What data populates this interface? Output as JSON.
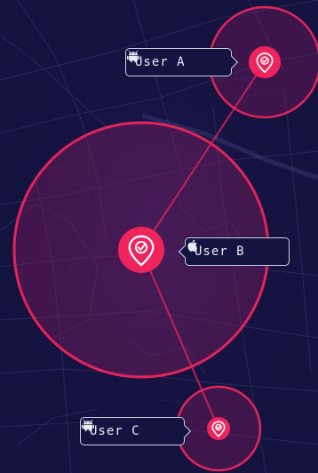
{
  "colors": {
    "background": "#14123f",
    "radius_stroke": "#e3245a",
    "marker_fill": "#f0245c",
    "street_lines": "#3a3870"
  },
  "users": [
    {
      "label": "User A",
      "platform_icon": "android-icon"
    },
    {
      "label": "User B",
      "platform_icon": "apple-icon"
    },
    {
      "label": "User C",
      "platform_icon": "android-icon"
    }
  ],
  "marker_icon": "location-check-pin-icon"
}
